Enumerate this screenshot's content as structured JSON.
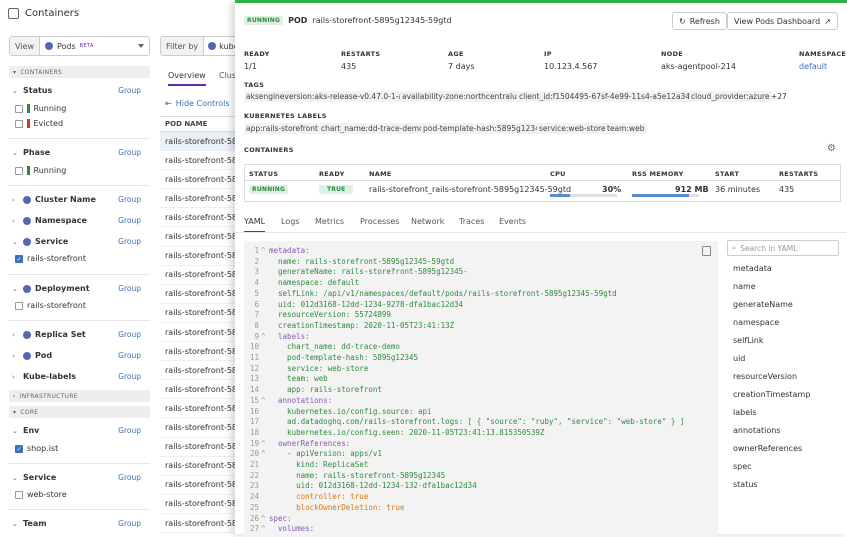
{
  "app_title": "Containers",
  "view": {
    "label": "View",
    "value": "Pods",
    "beta": "BETA"
  },
  "sections": {
    "containers": "CONTAINERS",
    "infrastructure": "INFRASTRUCTURE",
    "core": "CORE"
  },
  "group_label": "Group",
  "facets": {
    "status": {
      "title": "Status",
      "options": [
        "Running",
        "Evicted"
      ]
    },
    "phase": {
      "title": "Phase",
      "options": [
        "Running"
      ]
    },
    "cluster_name": "Cluster Name",
    "namespace": "Namespace",
    "service": {
      "title": "Service",
      "options": [
        "rails-storefront"
      ]
    },
    "deployment": {
      "title": "Deployment",
      "options": [
        "rails-storefront"
      ]
    },
    "replica_set": "Replica Set",
    "pod": "Pod",
    "kube_labels": "Kube-labels",
    "env": {
      "title": "Env",
      "options": [
        "shop.ist"
      ]
    },
    "service2": {
      "title": "Service",
      "options": [
        "web-store"
      ]
    },
    "team": "Team"
  },
  "filter": {
    "label": "Filter by",
    "value": "kube"
  },
  "mid_tabs": [
    "Overview",
    "Clust"
  ],
  "hide_controls": "Hide Controls",
  "pod_table": {
    "header": "POD NAME",
    "rows": [
      "rails-storefront-5895",
      "rails-storefront-5895",
      "rails-storefront-5895",
      "rails-storefront-5895",
      "rails-storefront-5895",
      "rails-storefront-5895",
      "rails-storefront-5895",
      "rails-storefront-5895",
      "rails-storefront-5895",
      "rails-storefront-5895",
      "rails-storefront-5895",
      "rails-storefront-5895",
      "rails-storefront-5895",
      "rails-storefront-5895",
      "rails-storefront-5895",
      "rails-storefront-5895",
      "rails-storefront-5895",
      "rails-storefront-5895",
      "rails-storefront-5895",
      "rails-storefront-5895",
      "rails-storefront-5895",
      "rails-storefront-5895"
    ]
  },
  "panel": {
    "status_badge": "RUNNING",
    "kind": "POD",
    "name": "rails-storefront-5895g12345-59gtd",
    "refresh": "Refresh",
    "view_dashboard": "View Pods Dashboard",
    "meta": [
      {
        "label": "READY",
        "value": "1/1"
      },
      {
        "label": "RESTARTS",
        "value": "435"
      },
      {
        "label": "AGE",
        "value": "7 days"
      },
      {
        "label": "IP",
        "value": "10.123.4.567"
      },
      {
        "label": "NODE",
        "value": "aks-agentpool-214"
      },
      {
        "label": "NAMESPACE",
        "value": "default"
      }
    ],
    "tags_title": "TAGS",
    "tags": [
      "aksengineversion:aks-release-v0.47.0-1-aks",
      "availability-zone:northcentralus",
      "client_id:f1504495-67sf-4e99-11s4-a5e12a34c863",
      "cloud_provider:azure",
      "+27"
    ],
    "labels_title": "KUBERNETES LABELS",
    "labels": [
      "app:rails-storefront",
      "chart_name:dd-trace-demo",
      "pod-template-hash:5895g12345",
      "service:web-store",
      "team:web"
    ],
    "containers_title": "CONTAINERS",
    "containers_table": {
      "headers": [
        "STATUS",
        "READY",
        "NAME",
        "CPU",
        "RSS MEMORY",
        "START",
        "RESTARTS"
      ],
      "row": {
        "status": "RUNNING",
        "ready": "TRUE",
        "name": "rails-storefront_rails-storefront-5895g12345-59gtd",
        "cpu": "30%",
        "cpu_fraction": 0.3,
        "memory": "912 MB",
        "memory_fraction": 0.85,
        "start": "36 minutes",
        "restarts": "435"
      }
    },
    "tabs": [
      "YAML",
      "Logs",
      "Metrics",
      "Processes",
      "Network",
      "Traces",
      "Events"
    ],
    "yaml_lines": [
      {
        "n": "1",
        "t": "metadata:",
        "c": "k"
      },
      {
        "n": "2",
        "t": "  name: rails-storefront-5895g12345-59gtd",
        "c": "s"
      },
      {
        "n": "3",
        "t": "  generateName: rails-storefront-5895g12345-",
        "c": "s"
      },
      {
        "n": "4",
        "t": "  namespace: default",
        "c": "s"
      },
      {
        "n": "5",
        "t": "  selfLink: /api/v1/namespaces/default/pods/rails-storefront-5895g12345-59gtd",
        "c": "s"
      },
      {
        "n": "6",
        "t": "  uid: 012d3168-12dd-1234-9278-dfa1bac12d34",
        "c": "s"
      },
      {
        "n": "7",
        "t": "  resourceVersion: 55724899",
        "c": "s"
      },
      {
        "n": "8",
        "t": "  creationTimestamp: 2020-11-05T23:41:13Z",
        "c": "s"
      },
      {
        "n": "9",
        "t": "  labels:",
        "c": "k"
      },
      {
        "n": "10",
        "t": "    chart_name: dd-trace-demo",
        "c": "s"
      },
      {
        "n": "11",
        "t": "    pod-template-hash: 5895g12345",
        "c": "s"
      },
      {
        "n": "12",
        "t": "    service: web-store",
        "c": "s"
      },
      {
        "n": "13",
        "t": "    team: web",
        "c": "s"
      },
      {
        "n": "14",
        "t": "    app: rails-storefront",
        "c": "s"
      },
      {
        "n": "15",
        "t": "  annotations:",
        "c": "k"
      },
      {
        "n": "16",
        "t": "    kubernetes.io/config.source: api",
        "c": "s"
      },
      {
        "n": "17",
        "t": "    ad.datadoghq.com/rails-storefront.logs: [ { \"source\": \"ruby\", \"service\": \"web-store\" } ]",
        "c": "s"
      },
      {
        "n": "18",
        "t": "    kubernetes.io/config.seen: 2020-11-05T23:41:13.815350539Z",
        "c": "s"
      },
      {
        "n": "19",
        "t": "  ownerReferences:",
        "c": "k"
      },
      {
        "n": "20",
        "t": "    - apiVersion: apps/v1",
        "c": "s"
      },
      {
        "n": "21",
        "t": "      kind: ReplicaSet",
        "c": "s"
      },
      {
        "n": "22",
        "t": "      name: rails-storefront-5895g12345",
        "c": "s"
      },
      {
        "n": "23",
        "t": "      uid: 012d3168-12dd-1234-132-dfa1bac12d34",
        "c": "s"
      },
      {
        "n": "24",
        "t": "      controller: true",
        "c": "b"
      },
      {
        "n": "25",
        "t": "      blockOwnerDeletion: true",
        "c": "b"
      },
      {
        "n": "26",
        "t": "spec:",
        "c": "k"
      },
      {
        "n": "27",
        "t": "  volumes:",
        "c": "k"
      }
    ],
    "yaml_search_placeholder": "Search in YAML",
    "yaml_outline": [
      "metadata",
      "name",
      "generateName",
      "namespace",
      "selfLink",
      "uid",
      "resourceVersion",
      "creationTimestamp",
      "labels",
      "annotations",
      "ownerReferences",
      "spec",
      "status"
    ]
  }
}
